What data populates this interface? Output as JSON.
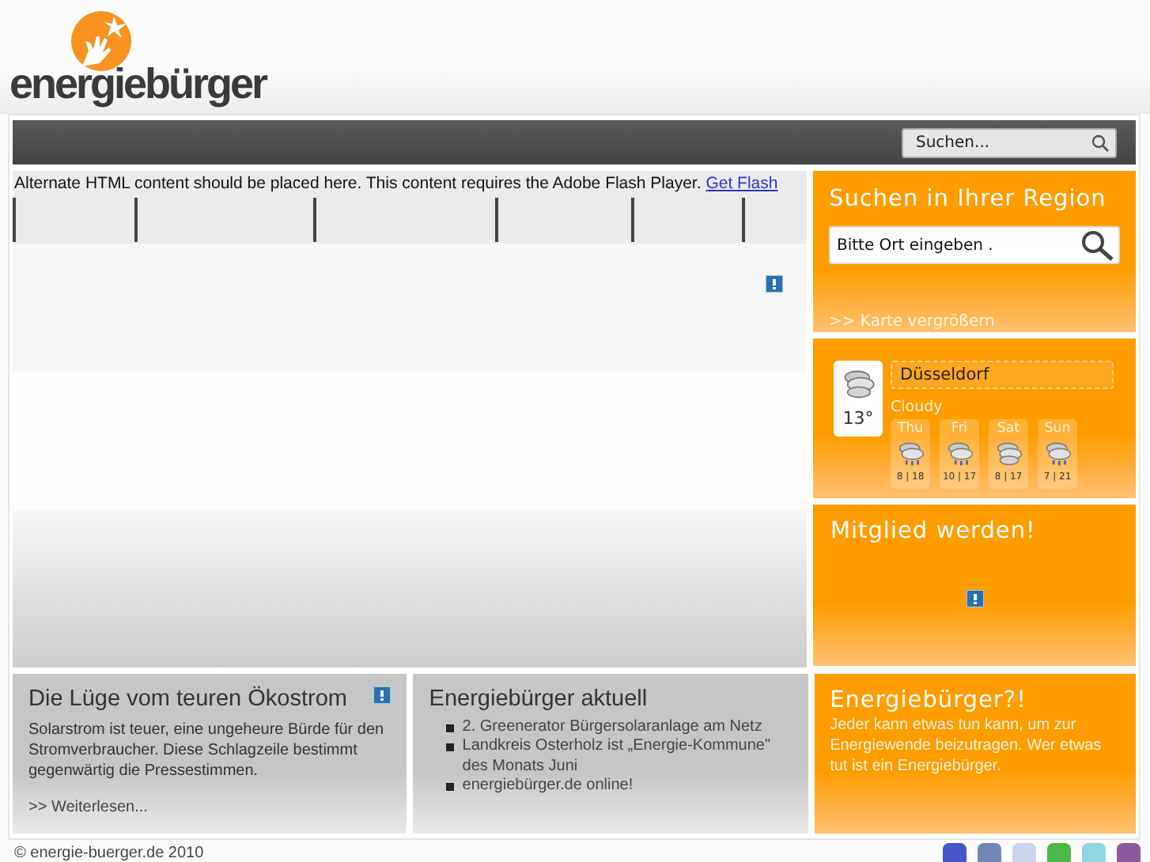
{
  "logo": {
    "text": "energiebürger"
  },
  "search": {
    "placeholder": "Suchen..."
  },
  "flash": {
    "notice": "Alternate HTML content should be placed here. This content requires the Adobe Flash Player.",
    "link": "Get Flash"
  },
  "region": {
    "title": "Suchen in Ihrer Region",
    "placeholder": "Bitte Ort eingeben .",
    "link": ">> Karte vergrößern"
  },
  "weather": {
    "city": "Düsseldorf",
    "temp": "13°",
    "condition": "Cloudy",
    "forecast": [
      {
        "day": "Thu",
        "range": "8 | 18",
        "kind": "rain"
      },
      {
        "day": "Fri",
        "range": "10 | 17",
        "kind": "rain"
      },
      {
        "day": "Sat",
        "range": "8 | 17",
        "kind": "cloudy"
      },
      {
        "day": "Sun",
        "range": "7 | 21",
        "kind": "rain"
      }
    ]
  },
  "member": {
    "title": "Mitglied werden!"
  },
  "article": {
    "title": "Die Lüge vom teuren Ökostrom",
    "text": "Solarstrom ist teuer, eine ungeheure Bürde für den Stromverbraucher. Diese Schlagzeile bestimmt gegenwärtig die Pressestimmen.",
    "link": ">> Weiterlesen..."
  },
  "news": {
    "title": "Energiebürger aktuell",
    "items": [
      "2. Greenerator Bürgersolaranlage am Netz",
      "Landkreis Osterholz ist „Energie-Kommune\" des Monats Juni",
      "energiebürger.de online!"
    ]
  },
  "about": {
    "title": "Energiebürger?!",
    "text": "Jeder kann etwas tun kann, um zur Energiewende beizutragen. Wer etwas tut ist ein Energiebürger."
  },
  "footer": {
    "copyright": "© energie-buerger.de 2010"
  }
}
